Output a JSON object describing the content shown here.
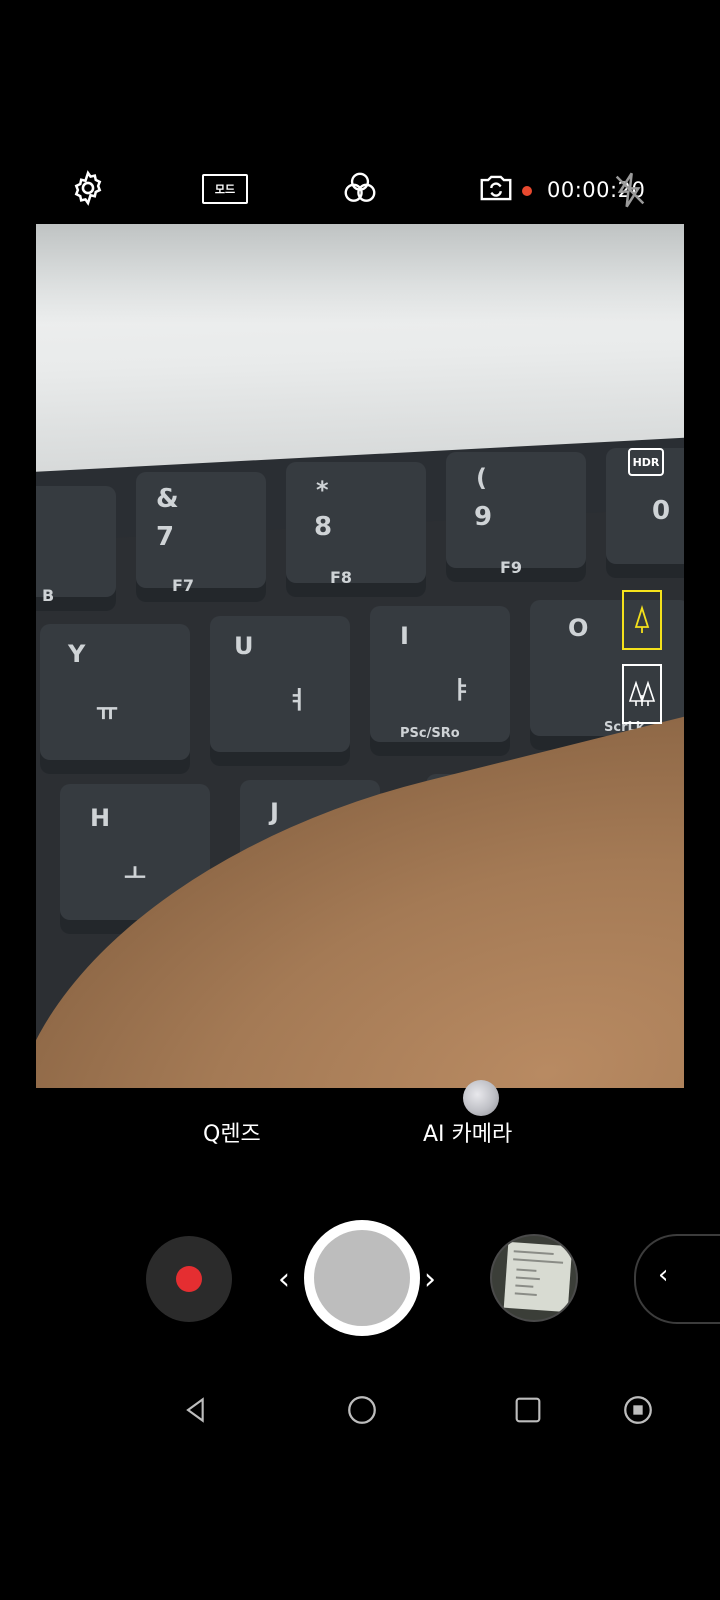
{
  "top_bar": {
    "settings_icon": "gear-icon",
    "mode_label": "모드",
    "filter_icon": "filter-circles-icon",
    "switch_camera_icon": "camera-switch-icon",
    "recording_indicator_color": "#e8492f",
    "timer": "00:00:20",
    "flash_icon": "flash-off-icon"
  },
  "viewfinder": {
    "hdr_label": "HDR",
    "keys": {
      "amp": "&",
      "seven": "7",
      "f7": "F7",
      "star": "*",
      "eight": "8",
      "f8": "F8",
      "paren": "(",
      "nine": "9",
      "f9": "F9",
      "zero": "0",
      "y": "Y",
      "yu": "ㅠ",
      "u": "U",
      "yeo": "ㅕ",
      "i": "I",
      "ya": "ㅑ",
      "psc": "PSc/SRo",
      "o": "O",
      "scr": "ScrLk",
      "h": "H",
      "o2": "ㅗ",
      "j": "J",
      "b": "B"
    },
    "lens_buttons": [
      {
        "icon": "single-tree-icon",
        "active": true,
        "active_color": "#f4e11b"
      },
      {
        "icon": "forest-icon",
        "active": false
      }
    ]
  },
  "modes": {
    "q_lens": "Q렌즈",
    "ai_camera": "AI 카메라"
  },
  "controls": {
    "record_color": "#e52e31",
    "prev_arrow": "‹",
    "next_arrow": "›",
    "drawer_arrow": "‹"
  },
  "nav_bar": {
    "back_icon": "back-triangle-icon",
    "home_icon": "home-circle-icon",
    "recents_icon": "recents-square-icon",
    "extra_icon": "record-screen-icon"
  }
}
